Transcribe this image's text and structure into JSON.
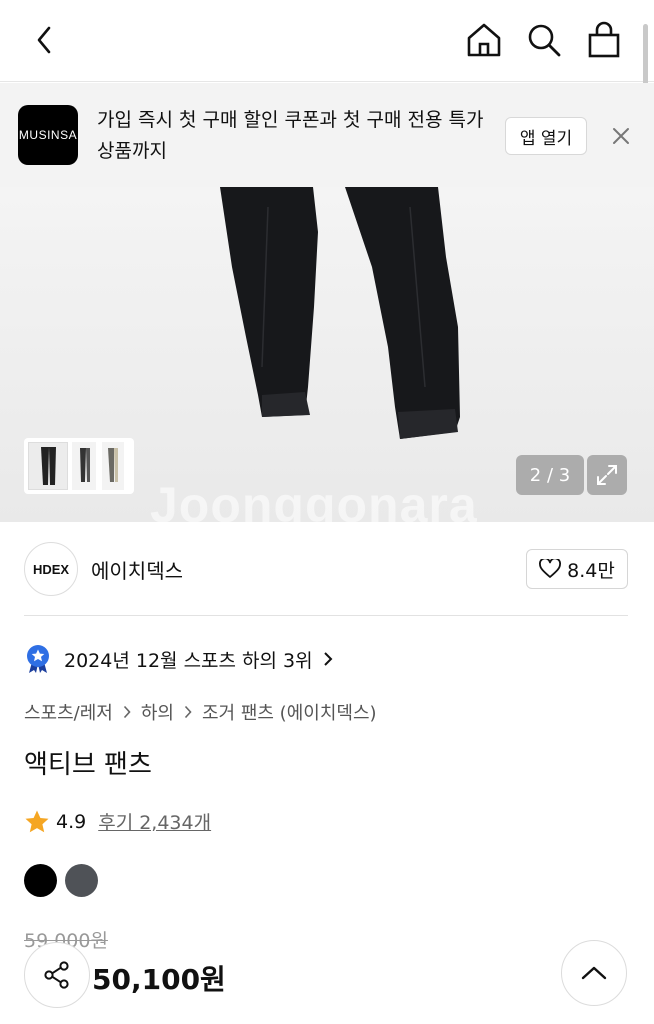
{
  "banner": {
    "logo_text": "MUSINSA",
    "message": "가입 즉시 첫 구매 할인 쿠폰과 첫 구매 전용 특가 상품까지",
    "open_label": "앱 열기"
  },
  "gallery": {
    "counter": "2 / 3",
    "watermark": "Joonggonara"
  },
  "brand": {
    "logo_text": "HDEX",
    "name": "에이치덱스",
    "likes": "8.4만"
  },
  "ranking": {
    "text": "2024년 12월 스포츠 하의 3위"
  },
  "breadcrumbs": [
    "스포츠/레저",
    "하의",
    "조거 팬츠 (에이치덱스)"
  ],
  "product": {
    "title": "액티브 팬츠",
    "rating": "4.9",
    "reviews": "후기 2,434개",
    "original_price": "59,000원",
    "price": "50,100원"
  },
  "colors": {
    "swatches": [
      "#000000",
      "#4f5257"
    ],
    "star": "#f5a623",
    "badge": "#2f6fe4"
  },
  "icons": [
    "back-arrow-icon",
    "home-icon",
    "search-icon",
    "shopping-bag-icon",
    "close-icon",
    "chevron-right-icon",
    "expand-icon",
    "heart-icon",
    "ranking-badge-icon",
    "star-icon",
    "share-icon",
    "chevron-up-icon"
  ]
}
